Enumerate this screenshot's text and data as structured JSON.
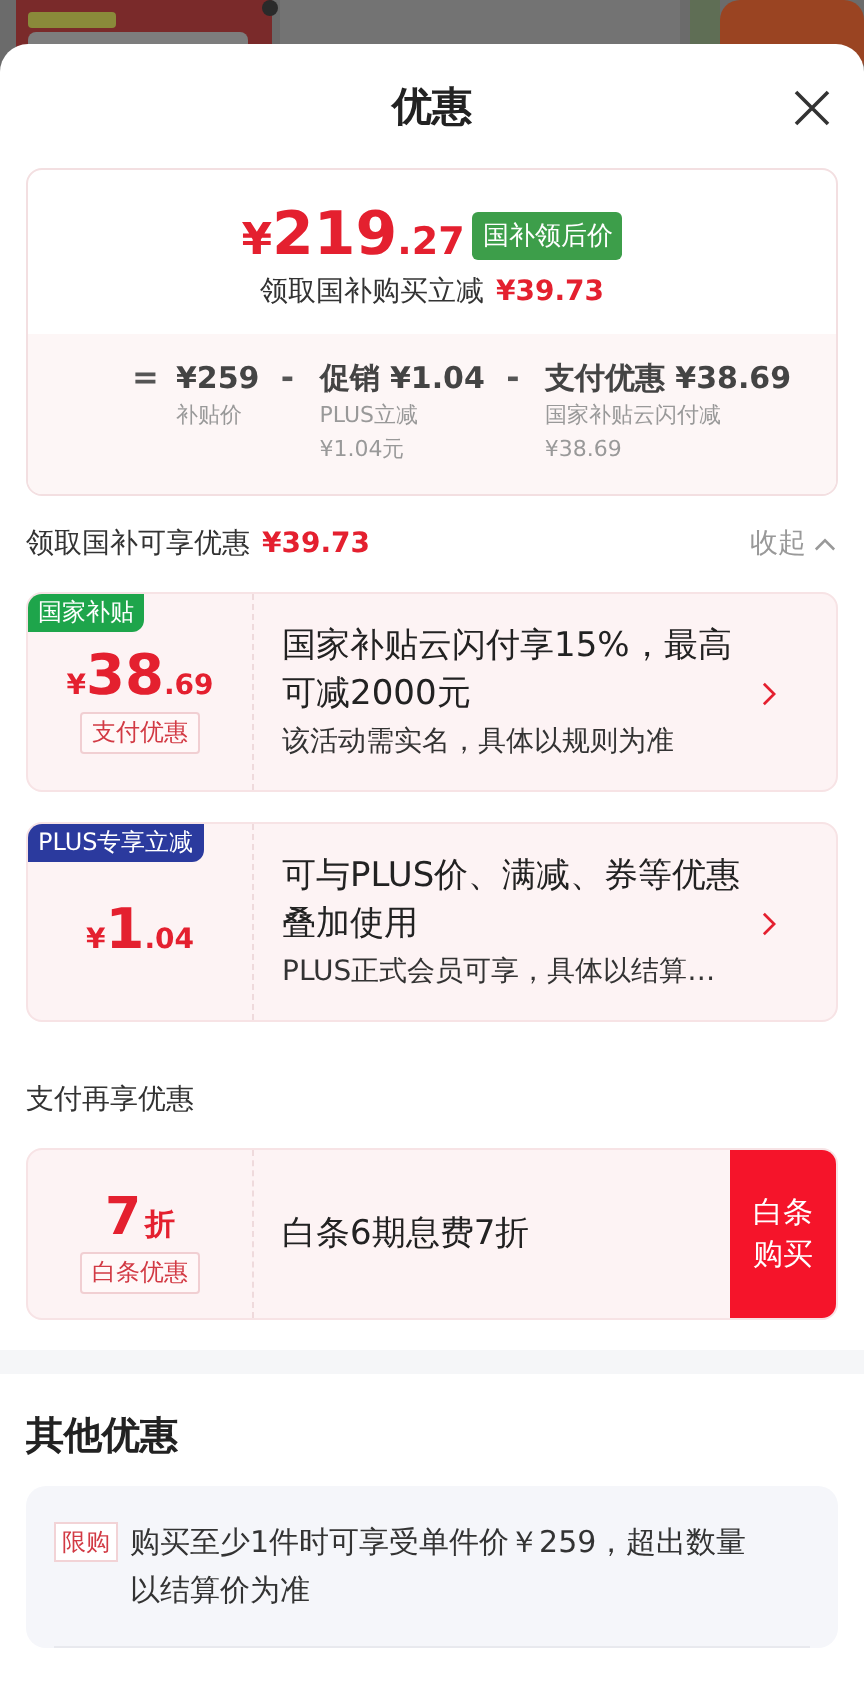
{
  "sheet": {
    "title": "优惠"
  },
  "summary": {
    "currency": "¥",
    "price_int": "219",
    "price_dec": ".27",
    "badge": "国补领后价",
    "subtitle": "领取国补购买立减",
    "subtitle_amount": "¥39.73",
    "breakdown": [
      {
        "op": "=",
        "value": "¥259",
        "notes": [
          "补贴价"
        ]
      },
      {
        "op": "-",
        "value": "促销 ¥1.04",
        "notes": [
          "PLUS立减",
          "¥1.04元"
        ]
      },
      {
        "op": "-",
        "value": "支付优惠 ¥38.69",
        "notes": [
          "国家补贴云闪付减",
          "¥38.69"
        ]
      }
    ]
  },
  "subsidy_section": {
    "title": "领取国补可享优惠",
    "amount": "¥39.73",
    "toggle": "收起",
    "expanded": true
  },
  "coupons": [
    {
      "tag": "国家补贴",
      "color": "#1ea54b",
      "currency": "¥",
      "amount_int": "38",
      "amount_dec": ".69",
      "label": "支付优惠",
      "title": "国家补贴云闪付享15%，最高可减2000元",
      "note": "该活动需实名，具体以规则为准"
    },
    {
      "tag": "PLUS专享立减",
      "color": "#2b3a9e",
      "currency": "¥",
      "amount_int": "1",
      "amount_dec": ".04",
      "title": "可与PLUS价、满减、券等优惠叠加使用",
      "note": "PLUS正式会员可享，具体以结算…"
    }
  ],
  "pay_section": {
    "title": "支付再享优惠",
    "offer": {
      "value": "7",
      "unit": "折",
      "label": "白条优惠",
      "title": "白条6期息费7折",
      "button": "白条购买"
    }
  },
  "other_section": {
    "title": "其他优惠",
    "items": [
      {
        "tag": "限购",
        "text": "购买至少1件时可享受单件价￥259，超出数量以结算价为准"
      }
    ]
  }
}
